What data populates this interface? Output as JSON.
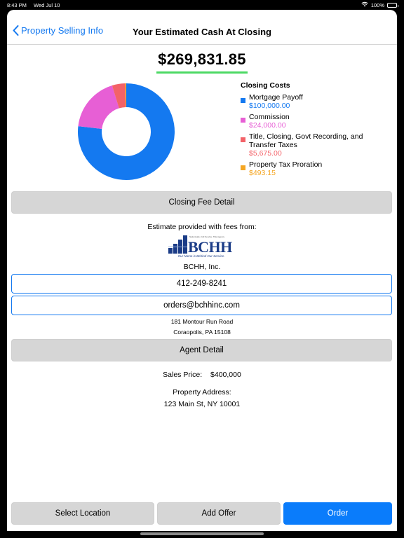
{
  "status_bar": {
    "time": "8:43 PM",
    "date": "Wed Jul 10",
    "battery": "100%"
  },
  "nav": {
    "back_label": "Property Selling Info",
    "title": "Your Estimated Cash At Closing"
  },
  "summary": {
    "total": "$269,831.85",
    "underline_color": "#4cd964"
  },
  "chart_data": {
    "type": "pie",
    "title": "Closing Costs",
    "series": [
      {
        "name": "Mortgage Payoff",
        "value": 100000.0,
        "label": "$100,000.00",
        "color": "#1479f0"
      },
      {
        "name": "Commission",
        "value": 24000.0,
        "label": "$24,000.00",
        "color": "#e75fd5"
      },
      {
        "name": "Title, Closing, Govt Recording, and Transfer Taxes",
        "value": 5675.0,
        "label": "$5,675.00",
        "color": "#f36268"
      },
      {
        "name": "Property Tax Proration",
        "value": 493.15,
        "label": "$493.15",
        "color": "#f5a623"
      }
    ]
  },
  "closing_fee_button": "Closing Fee Detail",
  "provider": {
    "intro": "Estimate provided with fees from:",
    "logo_name": "BCHH",
    "logo_small_text": "Nationwide, Full Service, Title Agency",
    "logo_tagline": "Our Name is Behind Our Service.",
    "company": "BCHH, Inc.",
    "phone": "412-249-8241",
    "email": "orders@bchhinc.com",
    "address_line1": "181 Montour Run Road",
    "address_line2": "Coraopolis, PA 15108"
  },
  "agent_button": "Agent Detail",
  "sale": {
    "price_label": "Sales Price:",
    "price_value": "$400,000",
    "address_label": "Property Address:",
    "address_value": "123 Main St, NY 10001"
  },
  "bottom_buttons": {
    "select_location": "Select Location",
    "add_offer": "Add Offer",
    "order": "Order"
  }
}
